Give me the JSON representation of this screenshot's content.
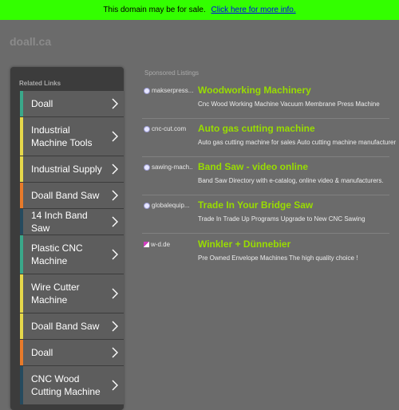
{
  "topbar": {
    "notice": "This domain may be for sale.",
    "link": "Click here for more info."
  },
  "domain": "doall.ca",
  "sidebar": {
    "title": "Related Links",
    "items": [
      {
        "label": "Doall",
        "accent": "#3aa88a"
      },
      {
        "label": "Industrial Machine Tools",
        "accent": "#e6d84a"
      },
      {
        "label": "Industrial Supply",
        "accent": "#e6d84a"
      },
      {
        "label": "Doall Band Saw",
        "accent": "#e87a2a"
      },
      {
        "label": "14 Inch Band Saw",
        "accent": "#264a5e"
      },
      {
        "label": "Plastic CNC Machine",
        "accent": "#3aa88a"
      },
      {
        "label": "Wire Cutter Machine",
        "accent": "#e6d84a"
      },
      {
        "label": "Doall Band Saw",
        "accent": "#e6d84a"
      },
      {
        "label": "Doall",
        "accent": "#e87a2a"
      },
      {
        "label": "CNC Wood Cutting Machine",
        "accent": "#264a5e"
      }
    ]
  },
  "sponsored": {
    "title": "Sponsored Listings",
    "listings": [
      {
        "source": "makserpress...",
        "headline": "Woodworking Machinery",
        "description": "Cnc Wood Working Machine Vacuum Membrane Press Machine",
        "icon": "globe-icon"
      },
      {
        "source": "cnc-cut.com",
        "headline": "Auto gas cutting machine",
        "description": "Auto gas cutting machine for sales Auto cutting machine manufacturer",
        "icon": "globe-icon"
      },
      {
        "source": "sawing-mach...",
        "headline": "Band Saw - video online",
        "description": "Band Saw Directory with e-catalog, online video & manufacturers.",
        "icon": "globe-icon"
      },
      {
        "source": "globalequip...",
        "headline": "Trade In Your Bridge Saw",
        "description": "Trade In Trade Up Programs Upgrade to New CNC Sawing",
        "icon": "globe-icon"
      },
      {
        "source": "w-d.de",
        "headline": "Winkler + Dünnebier",
        "description": "Pre Owned Envelope Machines The high quality choice !",
        "icon": "site-favicon"
      }
    ]
  },
  "colors": {
    "topbar": "#33ff00",
    "background": "#6b6b6b",
    "headline": "#99dd00"
  }
}
